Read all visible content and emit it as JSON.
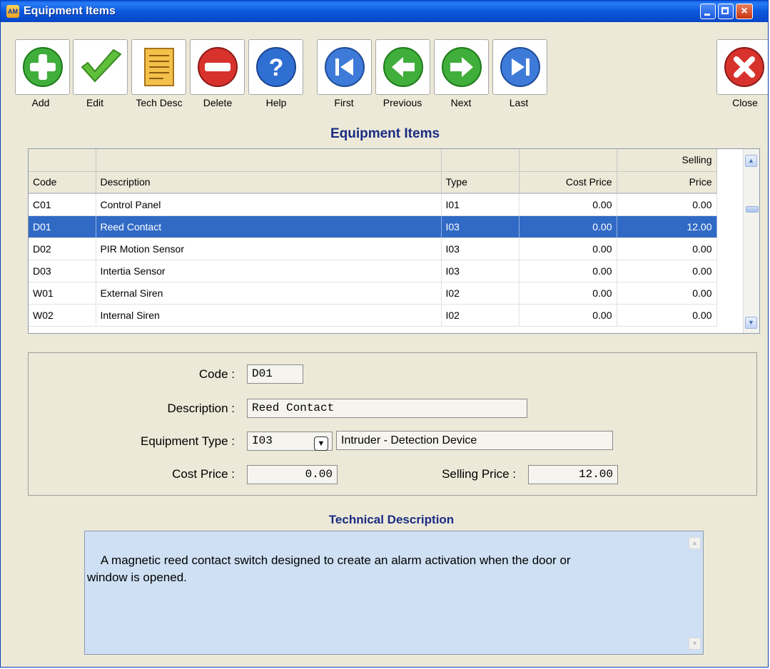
{
  "window": {
    "title": "Equipment Items",
    "app_icon_text": "AM",
    "close_glyph": "×"
  },
  "toolbar": [
    {
      "label": "Add",
      "icon": "add-icon"
    },
    {
      "label": "Edit",
      "icon": "edit-check-icon"
    },
    {
      "label": "Tech Desc",
      "icon": "tech-desc-notepad-icon"
    },
    {
      "label": "Delete",
      "icon": "delete-icon"
    },
    {
      "label": "Help",
      "icon": "help-icon"
    },
    {
      "label": "First",
      "icon": "first-record-icon"
    },
    {
      "label": "Previous",
      "icon": "previous-record-icon"
    },
    {
      "label": "Next",
      "icon": "next-record-icon"
    },
    {
      "label": "Last",
      "icon": "last-record-icon"
    },
    {
      "label": "Close",
      "icon": "close-circle-icon"
    }
  ],
  "heading": "Equipment Items",
  "grid": {
    "header_row1": [
      "",
      "",
      "",
      "",
      "Selling"
    ],
    "header_row2": [
      "Code",
      "Description",
      "Type",
      "Cost Price",
      "Price"
    ],
    "rows": [
      [
        "C01",
        "Control Panel",
        "I01",
        "0.00",
        "0.00"
      ],
      [
        "D01",
        "Reed Contact",
        "I03",
        "0.00",
        "12.00"
      ],
      [
        "D02",
        "PIR Motion Sensor",
        "I03",
        "0.00",
        "0.00"
      ],
      [
        "D03",
        "Intertia Sensor",
        "I03",
        "0.00",
        "0.00"
      ],
      [
        "W01",
        "External Siren",
        "I02",
        "0.00",
        "0.00"
      ],
      [
        "W02",
        "Internal Siren",
        "I02",
        "0.00",
        "0.00"
      ]
    ],
    "selected_row": 1,
    "scroll_up": "▲",
    "scroll_down": "▼"
  },
  "form": {
    "code_label": "Code :",
    "code_value": "D01",
    "description_label": "Description :",
    "description_value": "Reed Contact",
    "type_label": "Equipment Type :",
    "type_value": "I03",
    "type_dropdown_glyph": "▼",
    "type_name": "Intruder - Detection Device",
    "cost_label": "Cost Price :",
    "cost_value": "0.00",
    "selling_label": "Selling Price :",
    "selling_value": "12.00"
  },
  "technical": {
    "title": "Technical Description",
    "text": "A magnetic reed contact switch designed to create an alarm activation when the door or\nwindow is opened."
  },
  "colors": {
    "title_bar": "#0b58dd",
    "selection": "#316ac5",
    "heading": "#1a2c82",
    "tech_bg": "#cfe0f4",
    "window_bg": "#ece9d8"
  }
}
